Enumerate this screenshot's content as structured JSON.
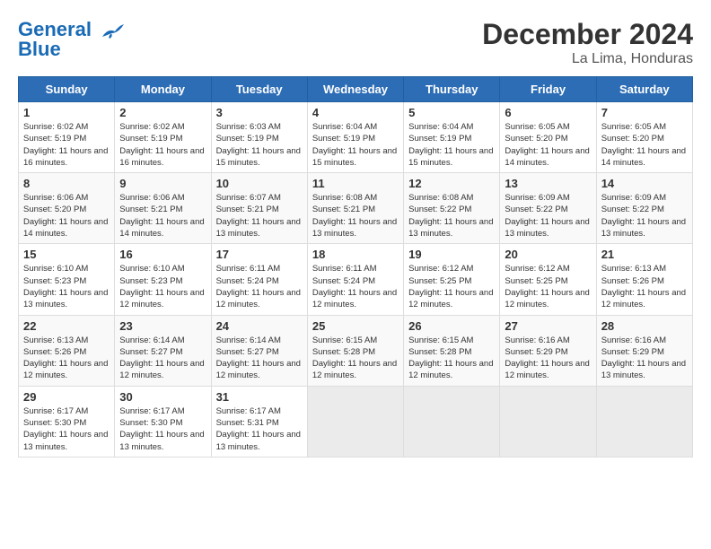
{
  "logo": {
    "line1": "General",
    "line2": "Blue"
  },
  "title": "December 2024",
  "subtitle": "La Lima, Honduras",
  "weekdays": [
    "Sunday",
    "Monday",
    "Tuesday",
    "Wednesday",
    "Thursday",
    "Friday",
    "Saturday"
  ],
  "weeks": [
    [
      {
        "day": 1,
        "sunrise": "6:02 AM",
        "sunset": "5:19 PM",
        "daylight": "11 hours and 16 minutes."
      },
      {
        "day": 2,
        "sunrise": "6:02 AM",
        "sunset": "5:19 PM",
        "daylight": "11 hours and 16 minutes."
      },
      {
        "day": 3,
        "sunrise": "6:03 AM",
        "sunset": "5:19 PM",
        "daylight": "11 hours and 15 minutes."
      },
      {
        "day": 4,
        "sunrise": "6:04 AM",
        "sunset": "5:19 PM",
        "daylight": "11 hours and 15 minutes."
      },
      {
        "day": 5,
        "sunrise": "6:04 AM",
        "sunset": "5:19 PM",
        "daylight": "11 hours and 15 minutes."
      },
      {
        "day": 6,
        "sunrise": "6:05 AM",
        "sunset": "5:20 PM",
        "daylight": "11 hours and 14 minutes."
      },
      {
        "day": 7,
        "sunrise": "6:05 AM",
        "sunset": "5:20 PM",
        "daylight": "11 hours and 14 minutes."
      }
    ],
    [
      {
        "day": 8,
        "sunrise": "6:06 AM",
        "sunset": "5:20 PM",
        "daylight": "11 hours and 14 minutes."
      },
      {
        "day": 9,
        "sunrise": "6:06 AM",
        "sunset": "5:21 PM",
        "daylight": "11 hours and 14 minutes."
      },
      {
        "day": 10,
        "sunrise": "6:07 AM",
        "sunset": "5:21 PM",
        "daylight": "11 hours and 13 minutes."
      },
      {
        "day": 11,
        "sunrise": "6:08 AM",
        "sunset": "5:21 PM",
        "daylight": "11 hours and 13 minutes."
      },
      {
        "day": 12,
        "sunrise": "6:08 AM",
        "sunset": "5:22 PM",
        "daylight": "11 hours and 13 minutes."
      },
      {
        "day": 13,
        "sunrise": "6:09 AM",
        "sunset": "5:22 PM",
        "daylight": "11 hours and 13 minutes."
      },
      {
        "day": 14,
        "sunrise": "6:09 AM",
        "sunset": "5:22 PM",
        "daylight": "11 hours and 13 minutes."
      }
    ],
    [
      {
        "day": 15,
        "sunrise": "6:10 AM",
        "sunset": "5:23 PM",
        "daylight": "11 hours and 13 minutes."
      },
      {
        "day": 16,
        "sunrise": "6:10 AM",
        "sunset": "5:23 PM",
        "daylight": "11 hours and 12 minutes."
      },
      {
        "day": 17,
        "sunrise": "6:11 AM",
        "sunset": "5:24 PM",
        "daylight": "11 hours and 12 minutes."
      },
      {
        "day": 18,
        "sunrise": "6:11 AM",
        "sunset": "5:24 PM",
        "daylight": "11 hours and 12 minutes."
      },
      {
        "day": 19,
        "sunrise": "6:12 AM",
        "sunset": "5:25 PM",
        "daylight": "11 hours and 12 minutes."
      },
      {
        "day": 20,
        "sunrise": "6:12 AM",
        "sunset": "5:25 PM",
        "daylight": "11 hours and 12 minutes."
      },
      {
        "day": 21,
        "sunrise": "6:13 AM",
        "sunset": "5:26 PM",
        "daylight": "11 hours and 12 minutes."
      }
    ],
    [
      {
        "day": 22,
        "sunrise": "6:13 AM",
        "sunset": "5:26 PM",
        "daylight": "11 hours and 12 minutes."
      },
      {
        "day": 23,
        "sunrise": "6:14 AM",
        "sunset": "5:27 PM",
        "daylight": "11 hours and 12 minutes."
      },
      {
        "day": 24,
        "sunrise": "6:14 AM",
        "sunset": "5:27 PM",
        "daylight": "11 hours and 12 minutes."
      },
      {
        "day": 25,
        "sunrise": "6:15 AM",
        "sunset": "5:28 PM",
        "daylight": "11 hours and 12 minutes."
      },
      {
        "day": 26,
        "sunrise": "6:15 AM",
        "sunset": "5:28 PM",
        "daylight": "11 hours and 12 minutes."
      },
      {
        "day": 27,
        "sunrise": "6:16 AM",
        "sunset": "5:29 PM",
        "daylight": "11 hours and 12 minutes."
      },
      {
        "day": 28,
        "sunrise": "6:16 AM",
        "sunset": "5:29 PM",
        "daylight": "11 hours and 13 minutes."
      }
    ],
    [
      {
        "day": 29,
        "sunrise": "6:17 AM",
        "sunset": "5:30 PM",
        "daylight": "11 hours and 13 minutes."
      },
      {
        "day": 30,
        "sunrise": "6:17 AM",
        "sunset": "5:30 PM",
        "daylight": "11 hours and 13 minutes."
      },
      {
        "day": 31,
        "sunrise": "6:17 AM",
        "sunset": "5:31 PM",
        "daylight": "11 hours and 13 minutes."
      },
      null,
      null,
      null,
      null
    ]
  ]
}
